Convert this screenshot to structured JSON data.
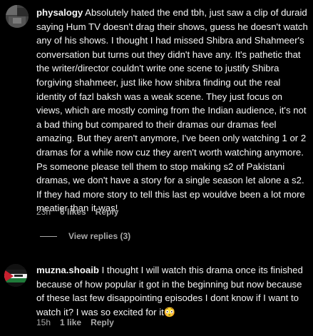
{
  "comments": [
    {
      "username": "physalogy",
      "text": "Absolutely hated the end tbh, just saw a clip of duraid saying Hum TV doesn't drag their shows, guess he doesn't watch any of his shows. I thought I had missed Shibra and Shahmeer's conversation but turns out they didn't have any. It's pathetic that the writer/director couldn't write one scene to justify Shibra forgiving shahmeer, just like how shibra finding out the real identity of fazl baksh was a weak scene. They just focus on views, which are mostly coming from the Indian audience, it's not a bad thing but compared to their dramas our dramas feel amazing. But they aren't anymore, I've been only watching 1 or 2 dramas for a while now cuz they aren't worth watching anymore. Ps someone please tell them to stop making s2 of Pakistani dramas, we don't have a story for a single season let alone a s2. If they had more story to tell this last ep wouldve been a lot more meatier than it was!",
      "time": "23h",
      "likes": "6 likes",
      "reply": "Reply",
      "view_replies": "View replies (3)"
    },
    {
      "username": "muzna.shoaib",
      "text": "I thought I will watch this drama once its finished because of how popular it got in the beginning but now because of these last few disappointing episodes I dont know if I want to watch it? I was so excited for it",
      "emoji": "😳",
      "time": "15h",
      "likes": "1 like",
      "reply": "Reply"
    }
  ],
  "colors": {
    "background": "#000000",
    "text": "#f5f5f5",
    "secondary": "#a8a8a8"
  }
}
